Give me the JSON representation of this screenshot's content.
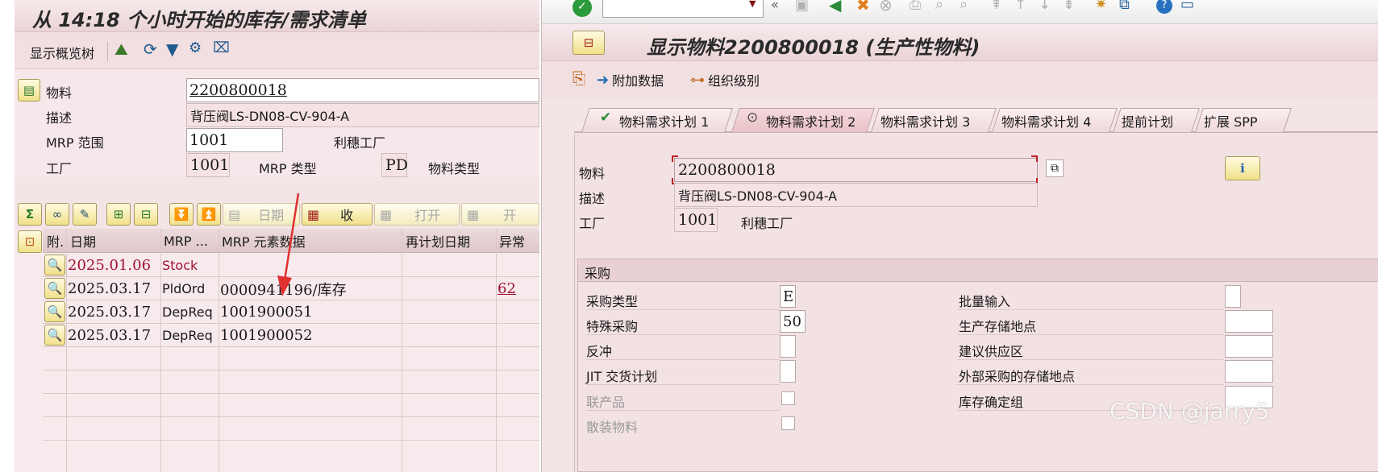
{
  "left": {
    "title": "从 14:18 个小时开始的库存/需求清单",
    "toolbar": {
      "overview_tree": "显示概览树"
    },
    "material_label": "物料",
    "material_value": "2200800018",
    "description_label": "描述",
    "description_value": "背压阀LS-DN08-CV-904-A",
    "mrp_area_label": "MRP 范围",
    "mrp_area_value": "1001",
    "mrp_area_text": "利穗工厂",
    "plant_label": "工厂",
    "plant_value": "1001",
    "mrp_type_label": "MRP 类型",
    "mrp_type_value": "PD",
    "material_type_label": "物料类型",
    "grid_toolbar": {
      "date": "日期",
      "receipts": "收",
      "open": "打开",
      "open2": "开"
    },
    "columns": [
      "附.",
      "日期",
      "MRP ...",
      "MRP 元素数据",
      "再计划日期",
      "异常"
    ],
    "rows": [
      {
        "date": "2025.01.06",
        "mrp": "Stock",
        "data": "",
        "exception": ""
      },
      {
        "date": "2025.03.17",
        "mrp": "PldOrd",
        "data": "0000941196/库存",
        "exception": "62"
      },
      {
        "date": "2025.03.17",
        "mrp": "DepReq",
        "data": "1001900051",
        "exception": ""
      },
      {
        "date": "2025.03.17",
        "mrp": "DepReq",
        "data": "1001900052",
        "exception": ""
      }
    ]
  },
  "right": {
    "title": "显示物料2200800018 (生产性物料)",
    "toolbar": {
      "additional_data": "附加数据",
      "org_levels": "组织级别"
    },
    "tabs": [
      "物料需求计划 1",
      "物料需求计划 2",
      "物料需求计划 3",
      "物料需求计划 4",
      "提前计划",
      "扩展 SPP"
    ],
    "material_label": "物料",
    "material_value": "2200800018",
    "description_label": "描述",
    "description_value": "背压阀LS-DN08-CV-904-A",
    "plant_label": "工厂",
    "plant_value": "1001",
    "plant_text": "利穗工厂",
    "procurement": {
      "group_title": "采购",
      "proc_type_label": "采购类型",
      "proc_type_value": "E",
      "special_proc_label": "特殊采购",
      "special_proc_value": "50",
      "backflush_label": "反冲",
      "jit_label": "JIT 交货计划",
      "coproduct_label": "联产品",
      "bulk_label": "散装物料",
      "batch_entry_label": "批量输入",
      "prod_storage_label": "生产存储地点",
      "supply_area_label": "建议供应区",
      "ext_storage_label": "外部采购的存储地点",
      "stock_det_label": "库存确定组"
    }
  },
  "watermark": "CSDN @jarry5"
}
